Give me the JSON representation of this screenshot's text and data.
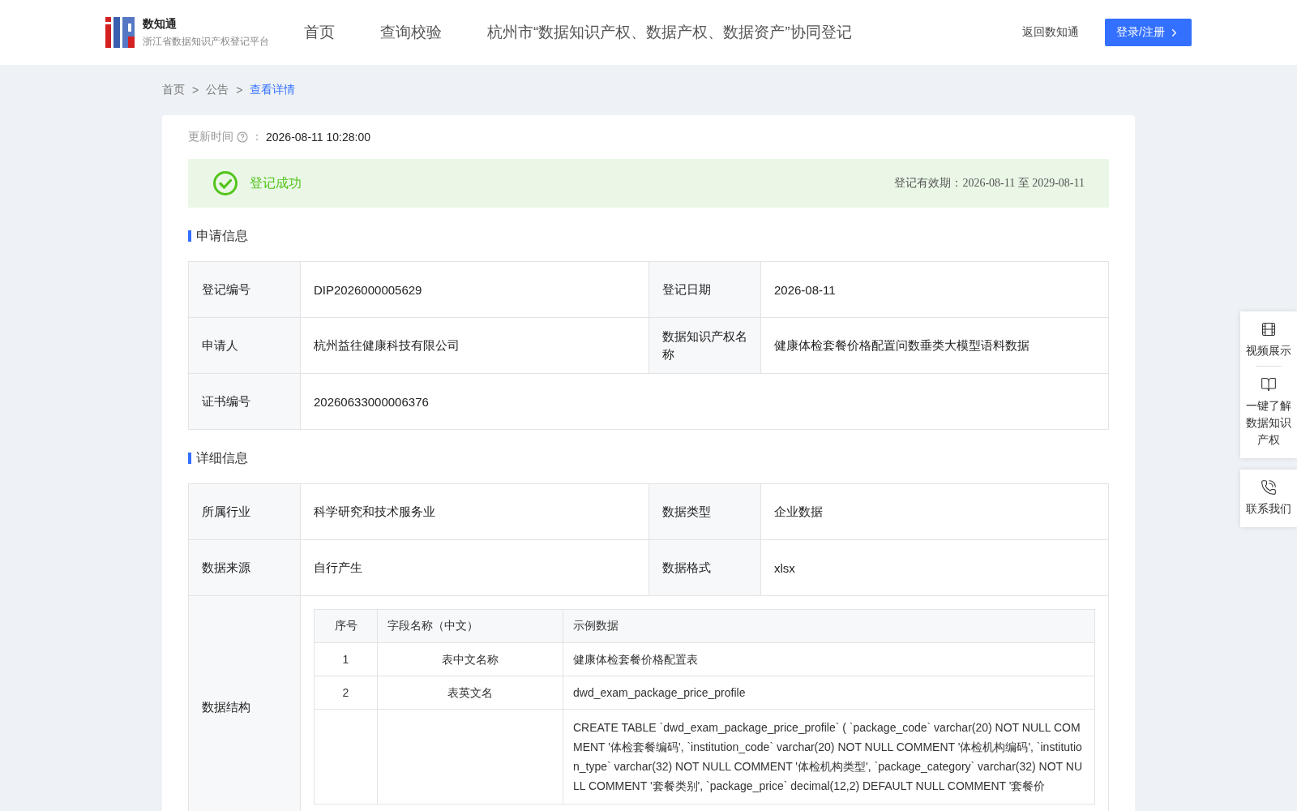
{
  "header": {
    "logo_title": "数知通",
    "logo_subtitle": "浙江省数据知识产权登记平台",
    "nav": [
      {
        "label": "首页",
        "selected": false
      },
      {
        "label": "查询校验",
        "selected": false
      },
      {
        "label": "杭州市“数据知识产权、数据产权、数据资产”协同登记",
        "selected": false
      }
    ],
    "back_link": "返回数知通",
    "login_button": "登录/注册"
  },
  "breadcrumb": [
    {
      "label": "首页",
      "current": false
    },
    {
      "label": "公告",
      "current": false
    },
    {
      "label": "查看详情",
      "current": true
    }
  ],
  "breadcrumb_separator": ">",
  "update": {
    "label": "更新时间",
    "separator": "：",
    "value": "2026-08-11 10:28:00"
  },
  "status": {
    "text": "登记成功",
    "validity": "登记有效期：2026-08-11 至 2029-08-11"
  },
  "sections": [
    {
      "title": "申请信息",
      "rows": [
        [
          {
            "label": "登记编号",
            "value": "DIP2026000005629"
          },
          {
            "label": "登记日期",
            "value": "2026-08-11"
          }
        ],
        [
          {
            "label": "申请人",
            "value": "杭州益往健康科技有限公司"
          },
          {
            "label": "数据知识产权名称",
            "value": "健康体检套餐价格配置问数垂类大模型语料数据"
          }
        ],
        [
          {
            "label": "证书编号",
            "value": "20260633000006376"
          }
        ]
      ]
    },
    {
      "title": "详细信息",
      "rows": [
        [
          {
            "label": "所属行业",
            "value": "科学研究和技术服务业"
          },
          {
            "label": "数据类型",
            "value": "企业数据"
          }
        ],
        [
          {
            "label": "数据来源",
            "value": "自行产生"
          },
          {
            "label": "数据格式",
            "value": "xlsx"
          }
        ]
      ],
      "structure": {
        "label": "数据结构",
        "columns": [
          "序号",
          "字段名称（中文）",
          "示例数据"
        ],
        "rows": [
          {
            "index": "1",
            "name": "表中文名称",
            "example": "健康体检套餐价格配置表"
          },
          {
            "index": "2",
            "name": "表英文名",
            "example": "dwd_exam_package_price_profile"
          },
          {
            "example": "CREATE TABLE `dwd_exam_package_price_profile` ( `package_code` varchar(20) NOT NULL COMMENT '体检套餐编码', `institution_code` varchar(20) NOT NULL COMMENT '体检机构编码', `institution_type` varchar(32) NOT NULL COMMENT '体检机构类型', `package_category` varchar(32) NOT NULL COMMENT '套餐类别', `package_price` decimal(12,2) DEFAULT NULL COMMENT '套餐价"
          }
        ]
      }
    }
  ],
  "side_panel": [
    {
      "kind": "video",
      "label": "视频展示"
    },
    {
      "kind": "guide",
      "label": "一键了解数据知识产权"
    },
    {
      "kind": "contact",
      "label": "联系我们"
    }
  ]
}
